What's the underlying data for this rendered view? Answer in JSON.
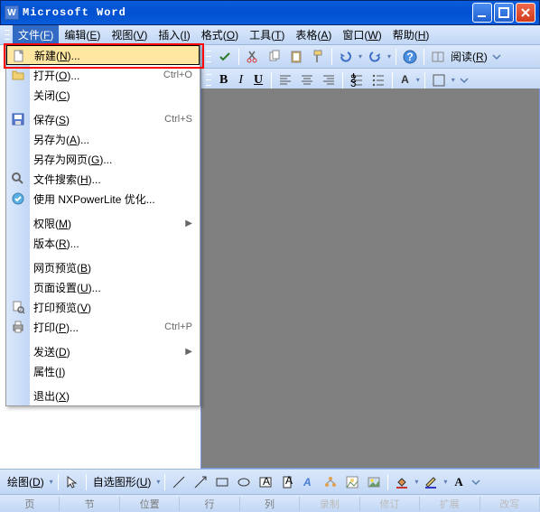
{
  "app_title": "Microsoft Word",
  "menubar": [
    {
      "label": "文件",
      "accel": "F",
      "open": true
    },
    {
      "label": "编辑",
      "accel": "E"
    },
    {
      "label": "视图",
      "accel": "V"
    },
    {
      "label": "插入",
      "accel": "I"
    },
    {
      "label": "格式",
      "accel": "O"
    },
    {
      "label": "工具",
      "accel": "T"
    },
    {
      "label": "表格",
      "accel": "A"
    },
    {
      "label": "窗口",
      "accel": "W"
    },
    {
      "label": "帮助",
      "accel": "H"
    }
  ],
  "toolbar2": {
    "read_label": "阅读",
    "read_accel": "R"
  },
  "toolbar3": {
    "bold": "B",
    "italic": "I",
    "underline": "U",
    "font_a": "A"
  },
  "file_menu": [
    {
      "t": "item",
      "icon": "new-doc",
      "label": "新建",
      "accel": "N",
      "suffix": "...",
      "highlight": true
    },
    {
      "t": "item",
      "icon": "folder-open",
      "label": "打开",
      "accel": "O",
      "suffix": "...",
      "shortcut": "Ctrl+O"
    },
    {
      "t": "item",
      "label": "关闭",
      "accel": "C"
    },
    {
      "t": "sep"
    },
    {
      "t": "item",
      "icon": "save",
      "label": "保存",
      "accel": "S",
      "shortcut": "Ctrl+S"
    },
    {
      "t": "item",
      "label": "另存为",
      "accel": "A",
      "suffix": "..."
    },
    {
      "t": "item",
      "label": "另存为网页",
      "accel": "G",
      "suffix": "..."
    },
    {
      "t": "item",
      "icon": "search",
      "label": "文件搜索",
      "accel": "H",
      "suffix": "..."
    },
    {
      "t": "item",
      "icon": "optimize",
      "label": "使用 NXPowerLite 优化..."
    },
    {
      "t": "sep"
    },
    {
      "t": "item",
      "label": "权限",
      "accel": "M",
      "arrow": true
    },
    {
      "t": "item",
      "label": "版本",
      "accel": "R",
      "suffix": "..."
    },
    {
      "t": "sep"
    },
    {
      "t": "item",
      "label": "网页预览",
      "accel": "B"
    },
    {
      "t": "item",
      "label": "页面设置",
      "accel": "U",
      "suffix": "..."
    },
    {
      "t": "item",
      "icon": "print-preview",
      "label": "打印预览",
      "accel": "V"
    },
    {
      "t": "item",
      "icon": "print",
      "label": "打印",
      "accel": "P",
      "suffix": "...",
      "shortcut": "Ctrl+P"
    },
    {
      "t": "sep"
    },
    {
      "t": "item",
      "label": "发送",
      "accel": "D",
      "arrow": true
    },
    {
      "t": "item",
      "label": "属性",
      "accel": "I"
    },
    {
      "t": "sep"
    },
    {
      "t": "item",
      "label": "退出",
      "accel": "X"
    }
  ],
  "draw_toolbar": {
    "draw_label": "绘图",
    "draw_accel": "D",
    "autoshape_label": "自选图形",
    "autoshape_accel": "U"
  },
  "statusbar": [
    "页",
    "节",
    "位置",
    "行",
    "列",
    "录制",
    "修订",
    "扩展",
    "改写"
  ]
}
